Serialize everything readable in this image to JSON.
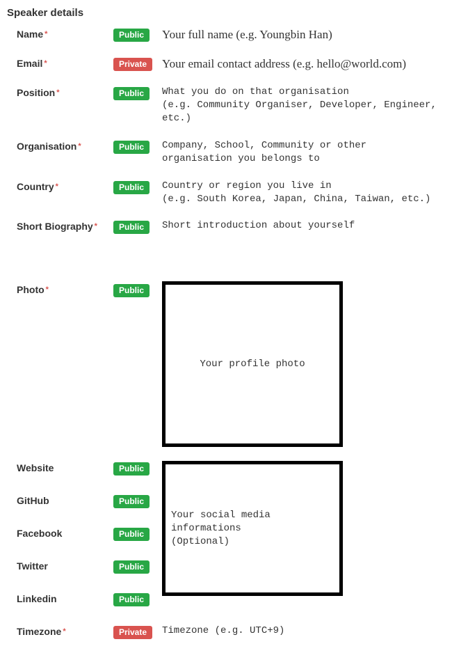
{
  "section_title": "Speaker details",
  "asterisk": "*",
  "badges": {
    "public": "Public",
    "private": "Private"
  },
  "fields": {
    "name": {
      "label": "Name",
      "desc": "Your full name (e.g. Youngbin Han)"
    },
    "email": {
      "label": "Email",
      "desc": "Your email contact address (e.g. hello@world.com)"
    },
    "position": {
      "label": "Position",
      "desc": "What you do on that organisation\n(e.g. Community Organiser, Developer, Engineer, etc.)"
    },
    "organisation": {
      "label": "Organisation",
      "desc": "Company, School, Community or other\norganisation you belongs to"
    },
    "country": {
      "label": "Country",
      "desc": "Country or region you live in\n(e.g. South Korea, Japan, China, Taiwan, etc.)"
    },
    "bio": {
      "label": "Short Biography",
      "desc": "Short introduction about yourself"
    },
    "photo": {
      "label": "Photo",
      "desc": "Your profile photo"
    },
    "website": {
      "label": "Website"
    },
    "github": {
      "label": "GitHub"
    },
    "facebook": {
      "label": "Facebook"
    },
    "twitter": {
      "label": "Twitter"
    },
    "linkedin": {
      "label": "Linkedin"
    },
    "social_desc": "Your social media informations\n(Optional)",
    "timezone": {
      "label": "Timezone",
      "desc": "Timezone (e.g. UTC+9)"
    }
  }
}
